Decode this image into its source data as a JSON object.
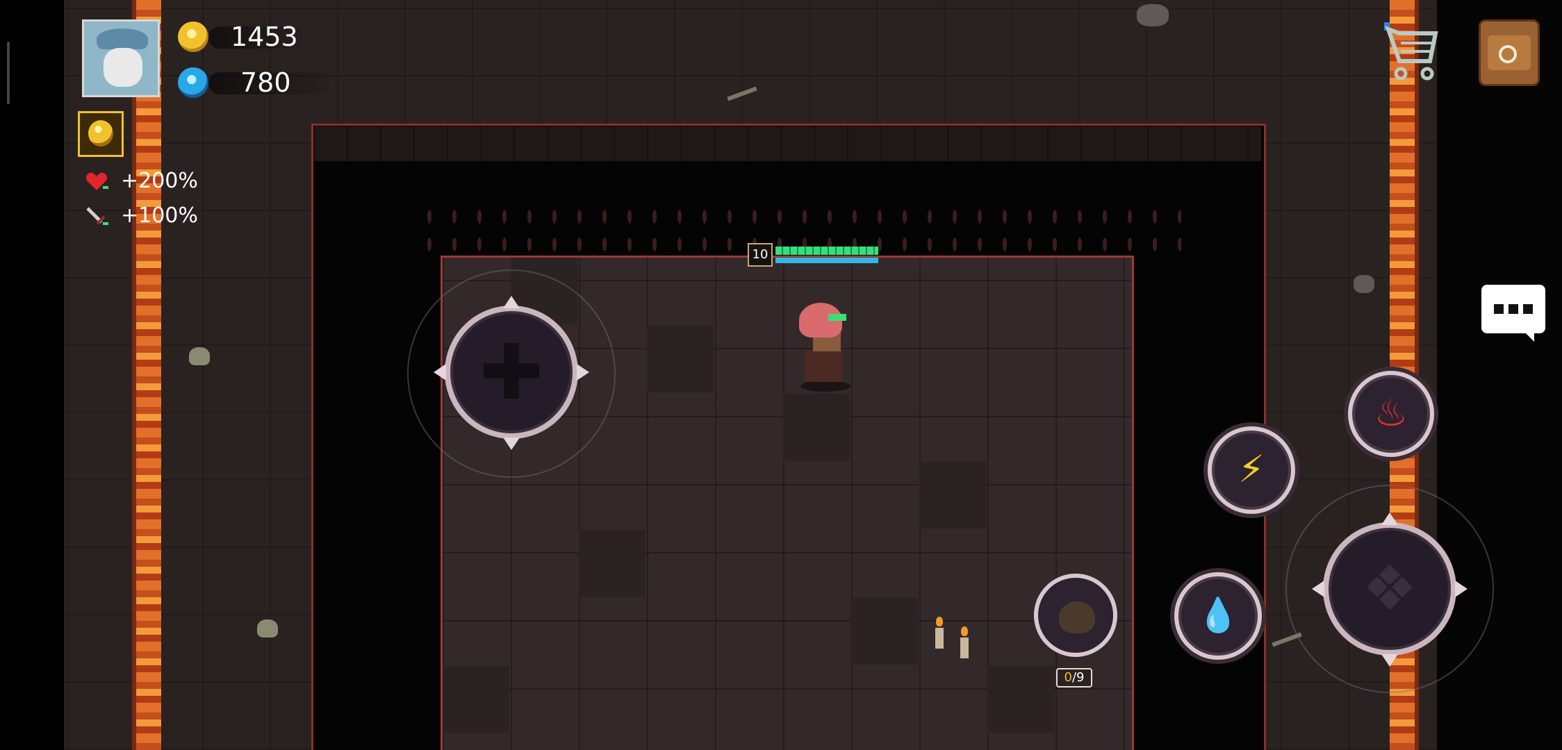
{
  "hud": {
    "gold_amount": "1453",
    "gem_amount": "780",
    "health_bonus": "+200%",
    "attack_bonus": "+100%"
  },
  "player": {
    "level": "10",
    "hp_fraction": 1.0,
    "mp_fraction": 1.0
  },
  "potion": {
    "current": "0",
    "max": "/9"
  },
  "icons": {
    "gold": "gold-coin-icon",
    "gem": "energy-gem-icon",
    "buff": "gold-gem-buff-icon",
    "heart": "heart-icon",
    "sword": "sword-icon",
    "cart": "shopping-cart-icon",
    "bag": "backpack-icon",
    "chat": "chat-bubble-icon",
    "skill_fire": "fire-skill-icon",
    "skill_lightning": "lightning-skill-icon",
    "skill_water": "water-drop-skill-icon"
  },
  "colors": {
    "gold": "#f2c12e",
    "gem": "#27a9e7",
    "hp": "#35e07a",
    "mp": "#31b7e6",
    "lava": "#e2702a",
    "wall_edge": "#9a3a36"
  }
}
